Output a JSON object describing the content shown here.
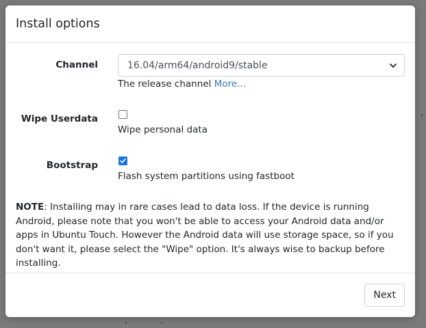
{
  "modal": {
    "title": "Install options"
  },
  "channel": {
    "label": "Channel",
    "selected": "16.04/arm64/android9/stable",
    "help_text": "The release channel",
    "help_link": "More..."
  },
  "wipe": {
    "label": "Wipe Userdata",
    "checked": false,
    "help_text": "Wipe personal data"
  },
  "bootstrap": {
    "label": "Bootstrap",
    "checked": true,
    "help_text": "Flash system partitions using fastboot"
  },
  "note": {
    "prefix": "NOTE",
    "text": ": Installing may in rare cases lead to data loss. If the device is running Android, please note that you won't be able to access your Android data and/or apps in Ubuntu Touch. However the Android data will use storage space, so if you don't want it, please select the \"Wipe\" option. It's always wise to backup before installing."
  },
  "footer": {
    "next_label": "Next"
  },
  "colors": {
    "accent": "#1a73e8",
    "link": "#3a78b5",
    "border": "#dee2e6"
  }
}
